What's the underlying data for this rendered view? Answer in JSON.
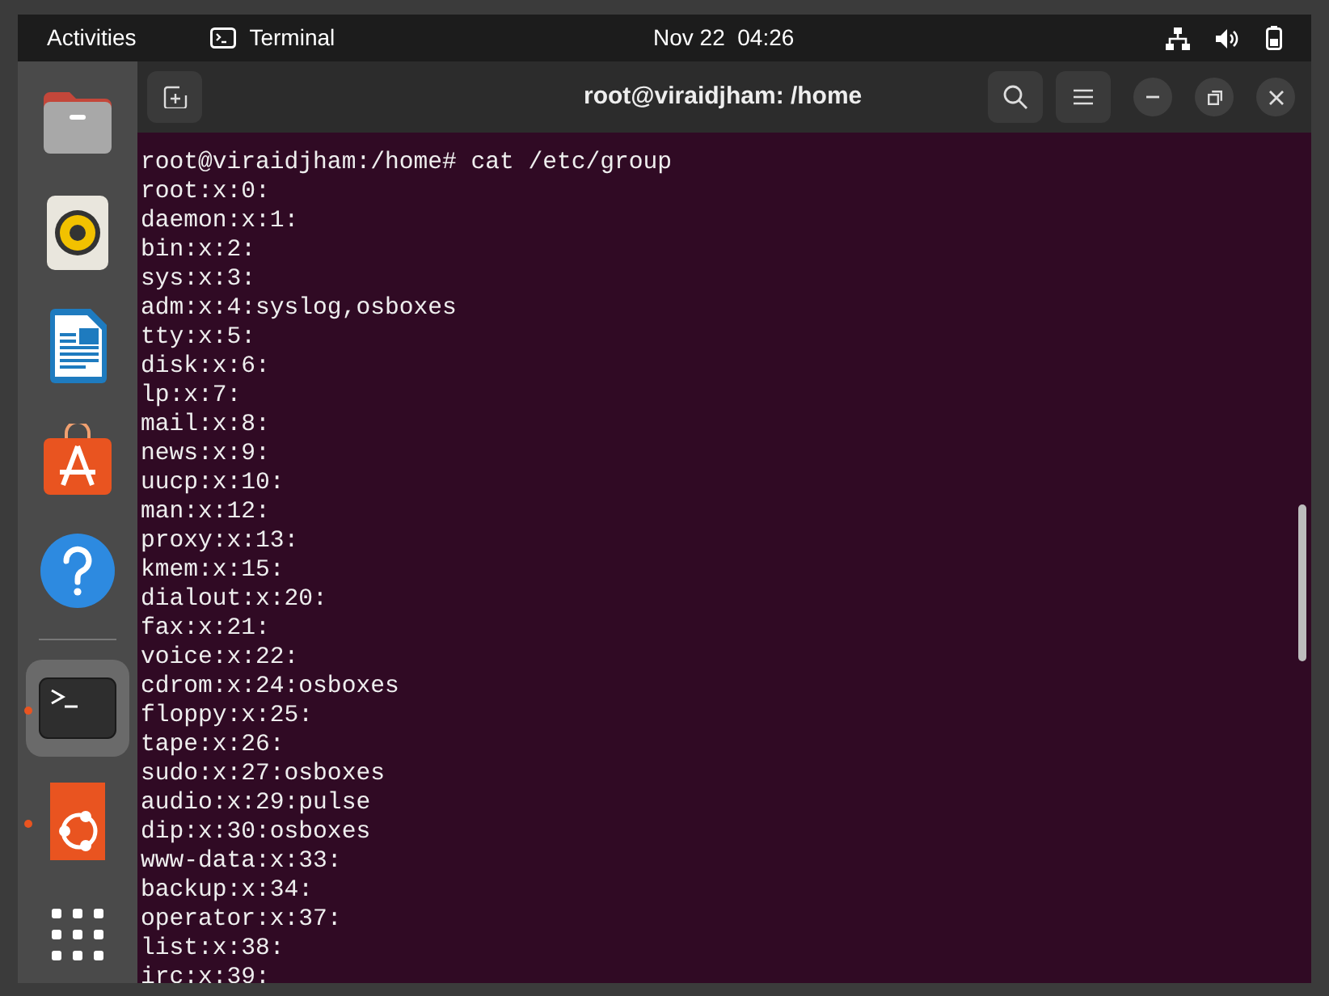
{
  "top_bar": {
    "activities": "Activities",
    "app_name": "Terminal",
    "clock": "Nov 22  04:26"
  },
  "dock": {
    "items": [
      {
        "kind": "files",
        "running": false,
        "selected": false
      },
      {
        "kind": "speaker",
        "running": false,
        "selected": false
      },
      {
        "kind": "document",
        "running": false,
        "selected": false
      },
      {
        "kind": "store",
        "running": false,
        "selected": false
      },
      {
        "kind": "help",
        "running": false,
        "selected": false
      },
      {
        "kind": "separator"
      },
      {
        "kind": "terminal",
        "running": true,
        "selected": true
      },
      {
        "kind": "ubuntu",
        "running": true,
        "selected": false
      },
      {
        "kind": "apps",
        "running": false,
        "selected": false
      }
    ]
  },
  "window": {
    "title": "root@viraidjham: /home"
  },
  "terminal": {
    "lines": [
      "root@viraidjham:/home# cat /etc/group",
      "root:x:0:",
      "daemon:x:1:",
      "bin:x:2:",
      "sys:x:3:",
      "adm:x:4:syslog,osboxes",
      "tty:x:5:",
      "disk:x:6:",
      "lp:x:7:",
      "mail:x:8:",
      "news:x:9:",
      "uucp:x:10:",
      "man:x:12:",
      "proxy:x:13:",
      "kmem:x:15:",
      "dialout:x:20:",
      "fax:x:21:",
      "voice:x:22:",
      "cdrom:x:24:osboxes",
      "floppy:x:25:",
      "tape:x:26:",
      "sudo:x:27:osboxes",
      "audio:x:29:pulse",
      "dip:x:30:osboxes",
      "www-data:x:33:",
      "backup:x:34:",
      "operator:x:37:",
      "list:x:38:",
      "irc:x:39:"
    ]
  }
}
